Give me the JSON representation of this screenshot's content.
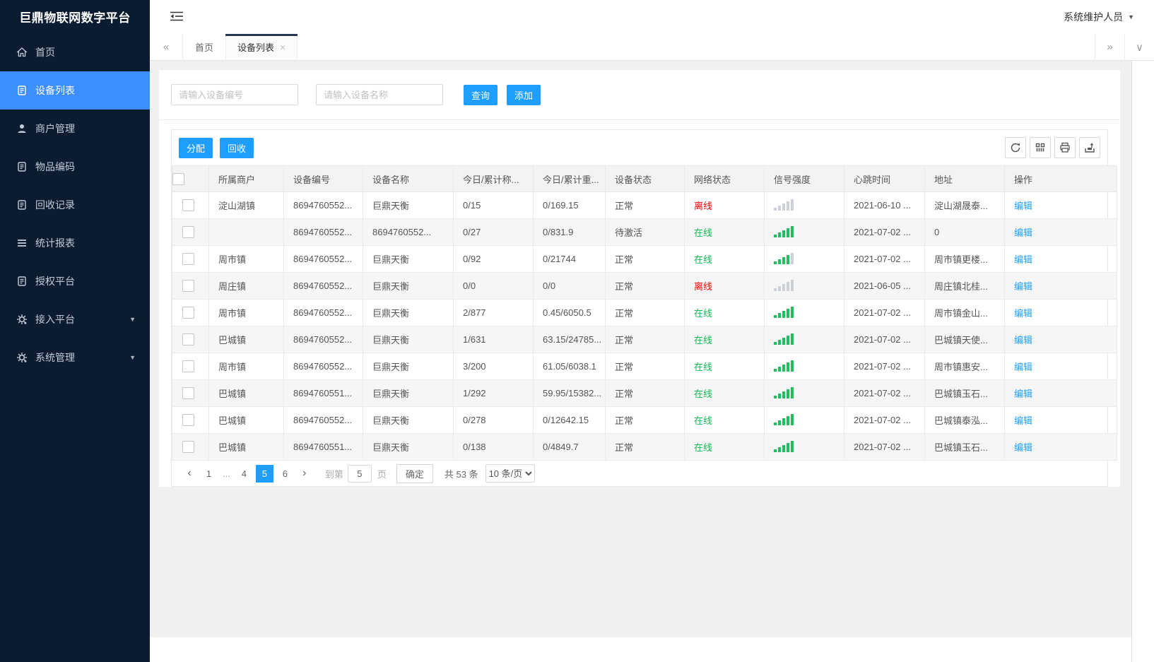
{
  "app": {
    "title": "巨鼎物联网数字平台",
    "user_name": "系统维护人员"
  },
  "sidebar": {
    "items": [
      {
        "key": "home",
        "label": "首页",
        "icon": "home-icon",
        "active": false,
        "arrow": false
      },
      {
        "key": "device-list",
        "label": "设备列表",
        "icon": "doc-icon",
        "active": true,
        "arrow": false
      },
      {
        "key": "merchant-management",
        "label": "商户管理",
        "icon": "user-icon",
        "active": false,
        "arrow": false
      },
      {
        "key": "item-code",
        "label": "物品编码",
        "icon": "doc-icon",
        "active": false,
        "arrow": false
      },
      {
        "key": "recycle-records",
        "label": "回收记录",
        "icon": "doc-icon",
        "active": false,
        "arrow": false
      },
      {
        "key": "statistics-report",
        "label": "统计报表",
        "icon": "report-icon",
        "active": false,
        "arrow": false
      },
      {
        "key": "authorization-platform",
        "label": "授权平台",
        "icon": "doc-icon",
        "active": false,
        "arrow": false
      },
      {
        "key": "access-platform",
        "label": "接入平台",
        "icon": "gear-icon",
        "active": false,
        "arrow": true
      },
      {
        "key": "system-management",
        "label": "系统管理",
        "icon": "gear-icon",
        "active": false,
        "arrow": true
      }
    ]
  },
  "tabs": {
    "items": [
      {
        "key": "home",
        "label": "首页",
        "active": false,
        "closable": false
      },
      {
        "key": "device-list",
        "label": "设备列表",
        "active": true,
        "closable": true
      }
    ]
  },
  "search": {
    "device_no_placeholder": "请输入设备编号",
    "device_name_placeholder": "请输入设备名称",
    "query_label": "查询",
    "add_label": "添加"
  },
  "toolbar": {
    "assign_label": "分配",
    "recycle_label": "回收",
    "icons": [
      "refresh-icon",
      "columns-icon",
      "print-icon",
      "export-icon"
    ]
  },
  "table": {
    "headers": [
      "所属商户",
      "设备编号",
      "设备名称",
      "今日/累计称...",
      "今日/累计重...",
      "设备状态",
      "网络状态",
      "信号强度",
      "心跳时间",
      "地址",
      "操作"
    ],
    "edit_label": "编辑",
    "rows": [
      {
        "merchant": "淀山湖镇",
        "device_no": "8694760552...",
        "device_name": "巨鼎天衡",
        "today_count": "0/15",
        "today_weight": "0/169.15",
        "device_status": "正常",
        "network_status": "离线",
        "online": false,
        "signal": 0,
        "heartbeat": "2021-06-10 ...",
        "address": "淀山湖晟泰..."
      },
      {
        "merchant": "",
        "device_no": "8694760552...",
        "device_name": "8694760552...",
        "today_count": "0/27",
        "today_weight": "0/831.9",
        "device_status": "待激活",
        "network_status": "在线",
        "online": true,
        "signal": 5,
        "heartbeat": "2021-07-02 ...",
        "address": "0"
      },
      {
        "merchant": "周市镇",
        "device_no": "8694760552...",
        "device_name": "巨鼎天衡",
        "today_count": "0/92",
        "today_weight": "0/21744",
        "device_status": "正常",
        "network_status": "在线",
        "online": true,
        "signal": 4,
        "heartbeat": "2021-07-02 ...",
        "address": "周市镇更楼..."
      },
      {
        "merchant": "周庄镇",
        "device_no": "8694760552...",
        "device_name": "巨鼎天衡",
        "today_count": "0/0",
        "today_weight": "0/0",
        "device_status": "正常",
        "network_status": "离线",
        "online": false,
        "signal": 0,
        "heartbeat": "2021-06-05 ...",
        "address": "周庄镇北桂..."
      },
      {
        "merchant": "周市镇",
        "device_no": "8694760552...",
        "device_name": "巨鼎天衡",
        "today_count": "2/877",
        "today_weight": "0.45/6050.5",
        "device_status": "正常",
        "network_status": "在线",
        "online": true,
        "signal": 5,
        "heartbeat": "2021-07-02 ...",
        "address": "周市镇金山..."
      },
      {
        "merchant": "巴城镇",
        "device_no": "8694760552...",
        "device_name": "巨鼎天衡",
        "today_count": "1/631",
        "today_weight": "63.15/24785...",
        "device_status": "正常",
        "network_status": "在线",
        "online": true,
        "signal": 5,
        "heartbeat": "2021-07-02 ...",
        "address": "巴城镇天使..."
      },
      {
        "merchant": "周市镇",
        "device_no": "8694760552...",
        "device_name": "巨鼎天衡",
        "today_count": "3/200",
        "today_weight": "61.05/6038.1",
        "device_status": "正常",
        "network_status": "在线",
        "online": true,
        "signal": 5,
        "heartbeat": "2021-07-02 ...",
        "address": "周市镇惠安..."
      },
      {
        "merchant": "巴城镇",
        "device_no": "8694760551...",
        "device_name": "巨鼎天衡",
        "today_count": "1/292",
        "today_weight": "59.95/15382...",
        "device_status": "正常",
        "network_status": "在线",
        "online": true,
        "signal": 5,
        "heartbeat": "2021-07-02 ...",
        "address": "巴城镇玉石..."
      },
      {
        "merchant": "巴城镇",
        "device_no": "8694760552...",
        "device_name": "巨鼎天衡",
        "today_count": "0/278",
        "today_weight": "0/12642.15",
        "device_status": "正常",
        "network_status": "在线",
        "online": true,
        "signal": 5,
        "heartbeat": "2021-07-02 ...",
        "address": "巴城镇泰泓..."
      },
      {
        "merchant": "巴城镇",
        "device_no": "8694760551...",
        "device_name": "巨鼎天衡",
        "today_count": "0/138",
        "today_weight": "0/4849.7",
        "device_status": "正常",
        "network_status": "在线",
        "online": true,
        "signal": 5,
        "heartbeat": "2021-07-02 ...",
        "address": "巴城镇玉石..."
      }
    ]
  },
  "pagination": {
    "pages": [
      "1",
      "...",
      "4",
      "5",
      "6"
    ],
    "current": "5",
    "goto_label": "到第",
    "goto_value": "5",
    "page_unit_label": "页",
    "confirm_label": "确定",
    "total_label": "共 53 条",
    "page_size_label": "10 条/页"
  },
  "colors": {
    "primary": "#1e9fff",
    "sidebar_active": "#3d8eff",
    "online_green": "#0db950",
    "offline_red": "#fe0000",
    "signal_green": "#1fbf5f",
    "signal_gray": "#ccd1d9",
    "link_blue": "#1e9fff"
  }
}
